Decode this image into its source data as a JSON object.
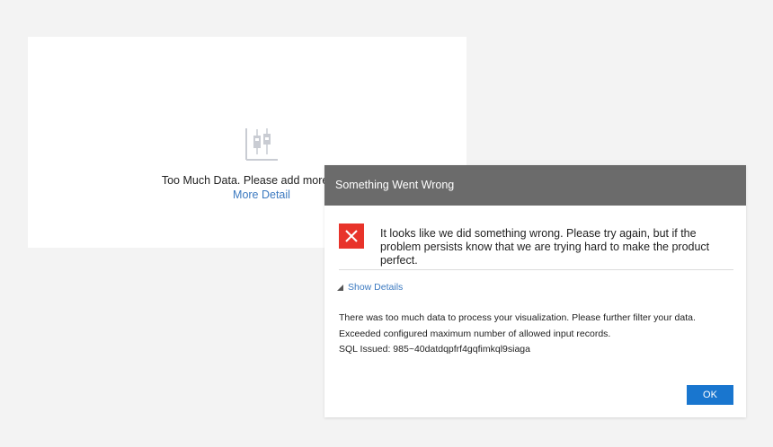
{
  "colors": {
    "page_background": "#f3f3f3",
    "card_background": "#ffffff",
    "link": "#3b79c0",
    "dialog_header": "#6b6b6b",
    "error_red": "#e8332a",
    "button_blue": "#1976cf"
  },
  "card": {
    "icon": "candlestick-chart-icon",
    "message": "Too Much Data. Please add more filters.",
    "link_label": "More Detail"
  },
  "dialog": {
    "title": "Something Went Wrong",
    "error_icon": "close-x-icon",
    "error_message": "It looks like we did something wrong. Please try again, but if the problem persists know that we are trying hard to make the product perfect.",
    "show_details_icon": "triangle-expanded-icon",
    "show_details_label": "Show Details",
    "details": [
      "There was too much data to process your visualization. Please further filter your data.",
      "Exceeded configured maximum number of allowed input records.",
      "SQL Issued: 985~40datdqpfrf4gqfimkql9siaga"
    ],
    "ok_label": "OK"
  }
}
